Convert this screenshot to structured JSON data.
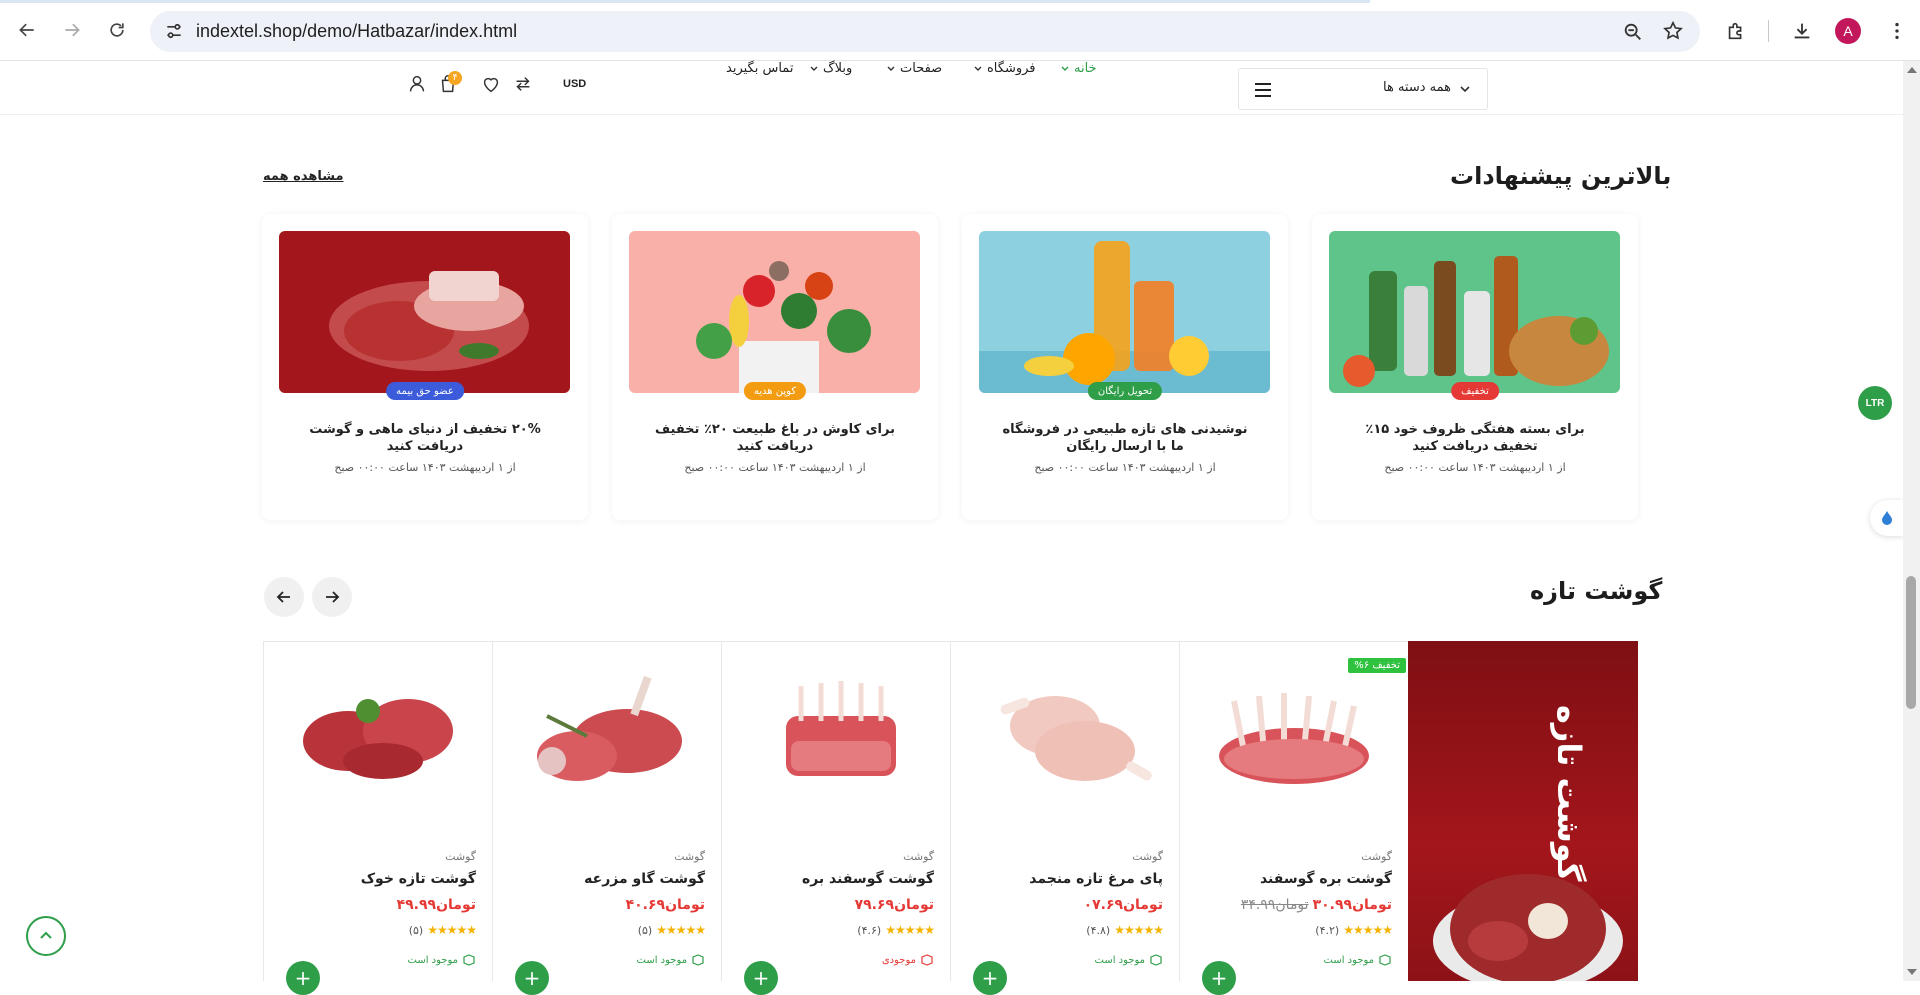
{
  "browser": {
    "url": "indextel.shop/demo/Hatbazar/index.html",
    "profile_initial": "A"
  },
  "header": {
    "categories_label": "همه دسته ها",
    "menu": [
      {
        "label": "خانه",
        "active": true,
        "dropdown": true
      },
      {
        "label": "فروشگاه",
        "active": false,
        "dropdown": true
      },
      {
        "label": "صفحات",
        "active": false,
        "dropdown": true
      },
      {
        "label": "وبلاگ",
        "active": false,
        "dropdown": true
      },
      {
        "label": "تماس بگیرید",
        "active": false,
        "dropdown": false
      }
    ],
    "currency": "USD",
    "cart_count": "۴"
  },
  "offers": {
    "title": "بالاترین پیشنهادات",
    "see_all": "مشاهده همه",
    "items": [
      {
        "badge": "تخفیف",
        "badge_color": "#e53935",
        "title": "برای بسته هفتگی ظروف خود ۱۵٪ تخفیف دریافت کنید",
        "date": "از ۱ اردیبهشت ۱۴۰۳ ساعت ۰۰:۰۰ صبح"
      },
      {
        "badge": "تحویل رایگان",
        "badge_color": "#2e9e49",
        "title": "نوشیدنی های تازه طبیعی در فروشگاه ما با ارسال رایگان",
        "date": "از ۱ اردیبهشت ۱۴۰۳ ساعت ۰۰:۰۰ صبح"
      },
      {
        "badge": "کوپن هدیه",
        "badge_color": "#f39c12",
        "title": "برای کاوش در باغ طبیعت ۲۰٪ تخفیف دریافت کنید",
        "date": "از ۱ اردیبهشت ۱۴۰۳ ساعت ۰۰:۰۰ صبح"
      },
      {
        "badge": "عضو حق بیمه",
        "badge_color": "#3b5bdb",
        "title": "۲۰% تخفیف از دنیای ماهی و گوشت دریافت کنید",
        "date": "از ۱ اردیبهشت ۱۴۰۳ ساعت ۰۰:۰۰ صبح"
      }
    ]
  },
  "fresh_meat": {
    "title": "گوشت تازه",
    "banner_text": "گوشت تازه",
    "discount_badge": "تخفیف ۶%",
    "products": [
      {
        "category": "گوشت",
        "name": "گوشت بره گوسفند",
        "price": "تومان۳۰.۹۹",
        "old_price": "تومان۳۴.۹۹",
        "rating": "(۴.۲)",
        "stock": "موجود است",
        "low_stock": false
      },
      {
        "category": "گوشت",
        "name": "پای مرغ تازه منجمد",
        "price": "تومان۰۷.۶۹",
        "old_price": "",
        "rating": "(۴.۸)",
        "stock": "موجود است",
        "low_stock": false
      },
      {
        "category": "گوشت",
        "name": "گوشت گوسفند بره",
        "price": "تومان۷۹.۶۹",
        "old_price": "",
        "rating": "(۴.۶)",
        "stock": "موجودی",
        "low_stock": true
      },
      {
        "category": "گوشت",
        "name": "گوشت گاو مزرعه",
        "price": "تومان۴۰.۶۹",
        "old_price": "",
        "rating": "(۵)",
        "stock": "موجود است",
        "low_stock": false
      },
      {
        "category": "گوشت",
        "name": "گوشت تازه خوک",
        "price": "تومان۴۹.۹۹",
        "old_price": "",
        "rating": "(۵)",
        "stock": "موجود است",
        "low_stock": false
      }
    ]
  },
  "widgets": {
    "ltr_label": "LTR"
  },
  "icons": {
    "back": "back-arrow-icon",
    "forward": "forward-arrow-icon",
    "reload": "reload-icon",
    "site_info": "site-settings-icon",
    "zoom": "zoom-icon",
    "bookmark": "star-icon",
    "extensions": "puzzle-icon",
    "download": "download-icon",
    "menu": "kebab-menu-icon"
  },
  "colors": {
    "accent": "#2e9e49",
    "price": "#e53935",
    "banner": "#a3161b",
    "star": "#f5b301"
  }
}
